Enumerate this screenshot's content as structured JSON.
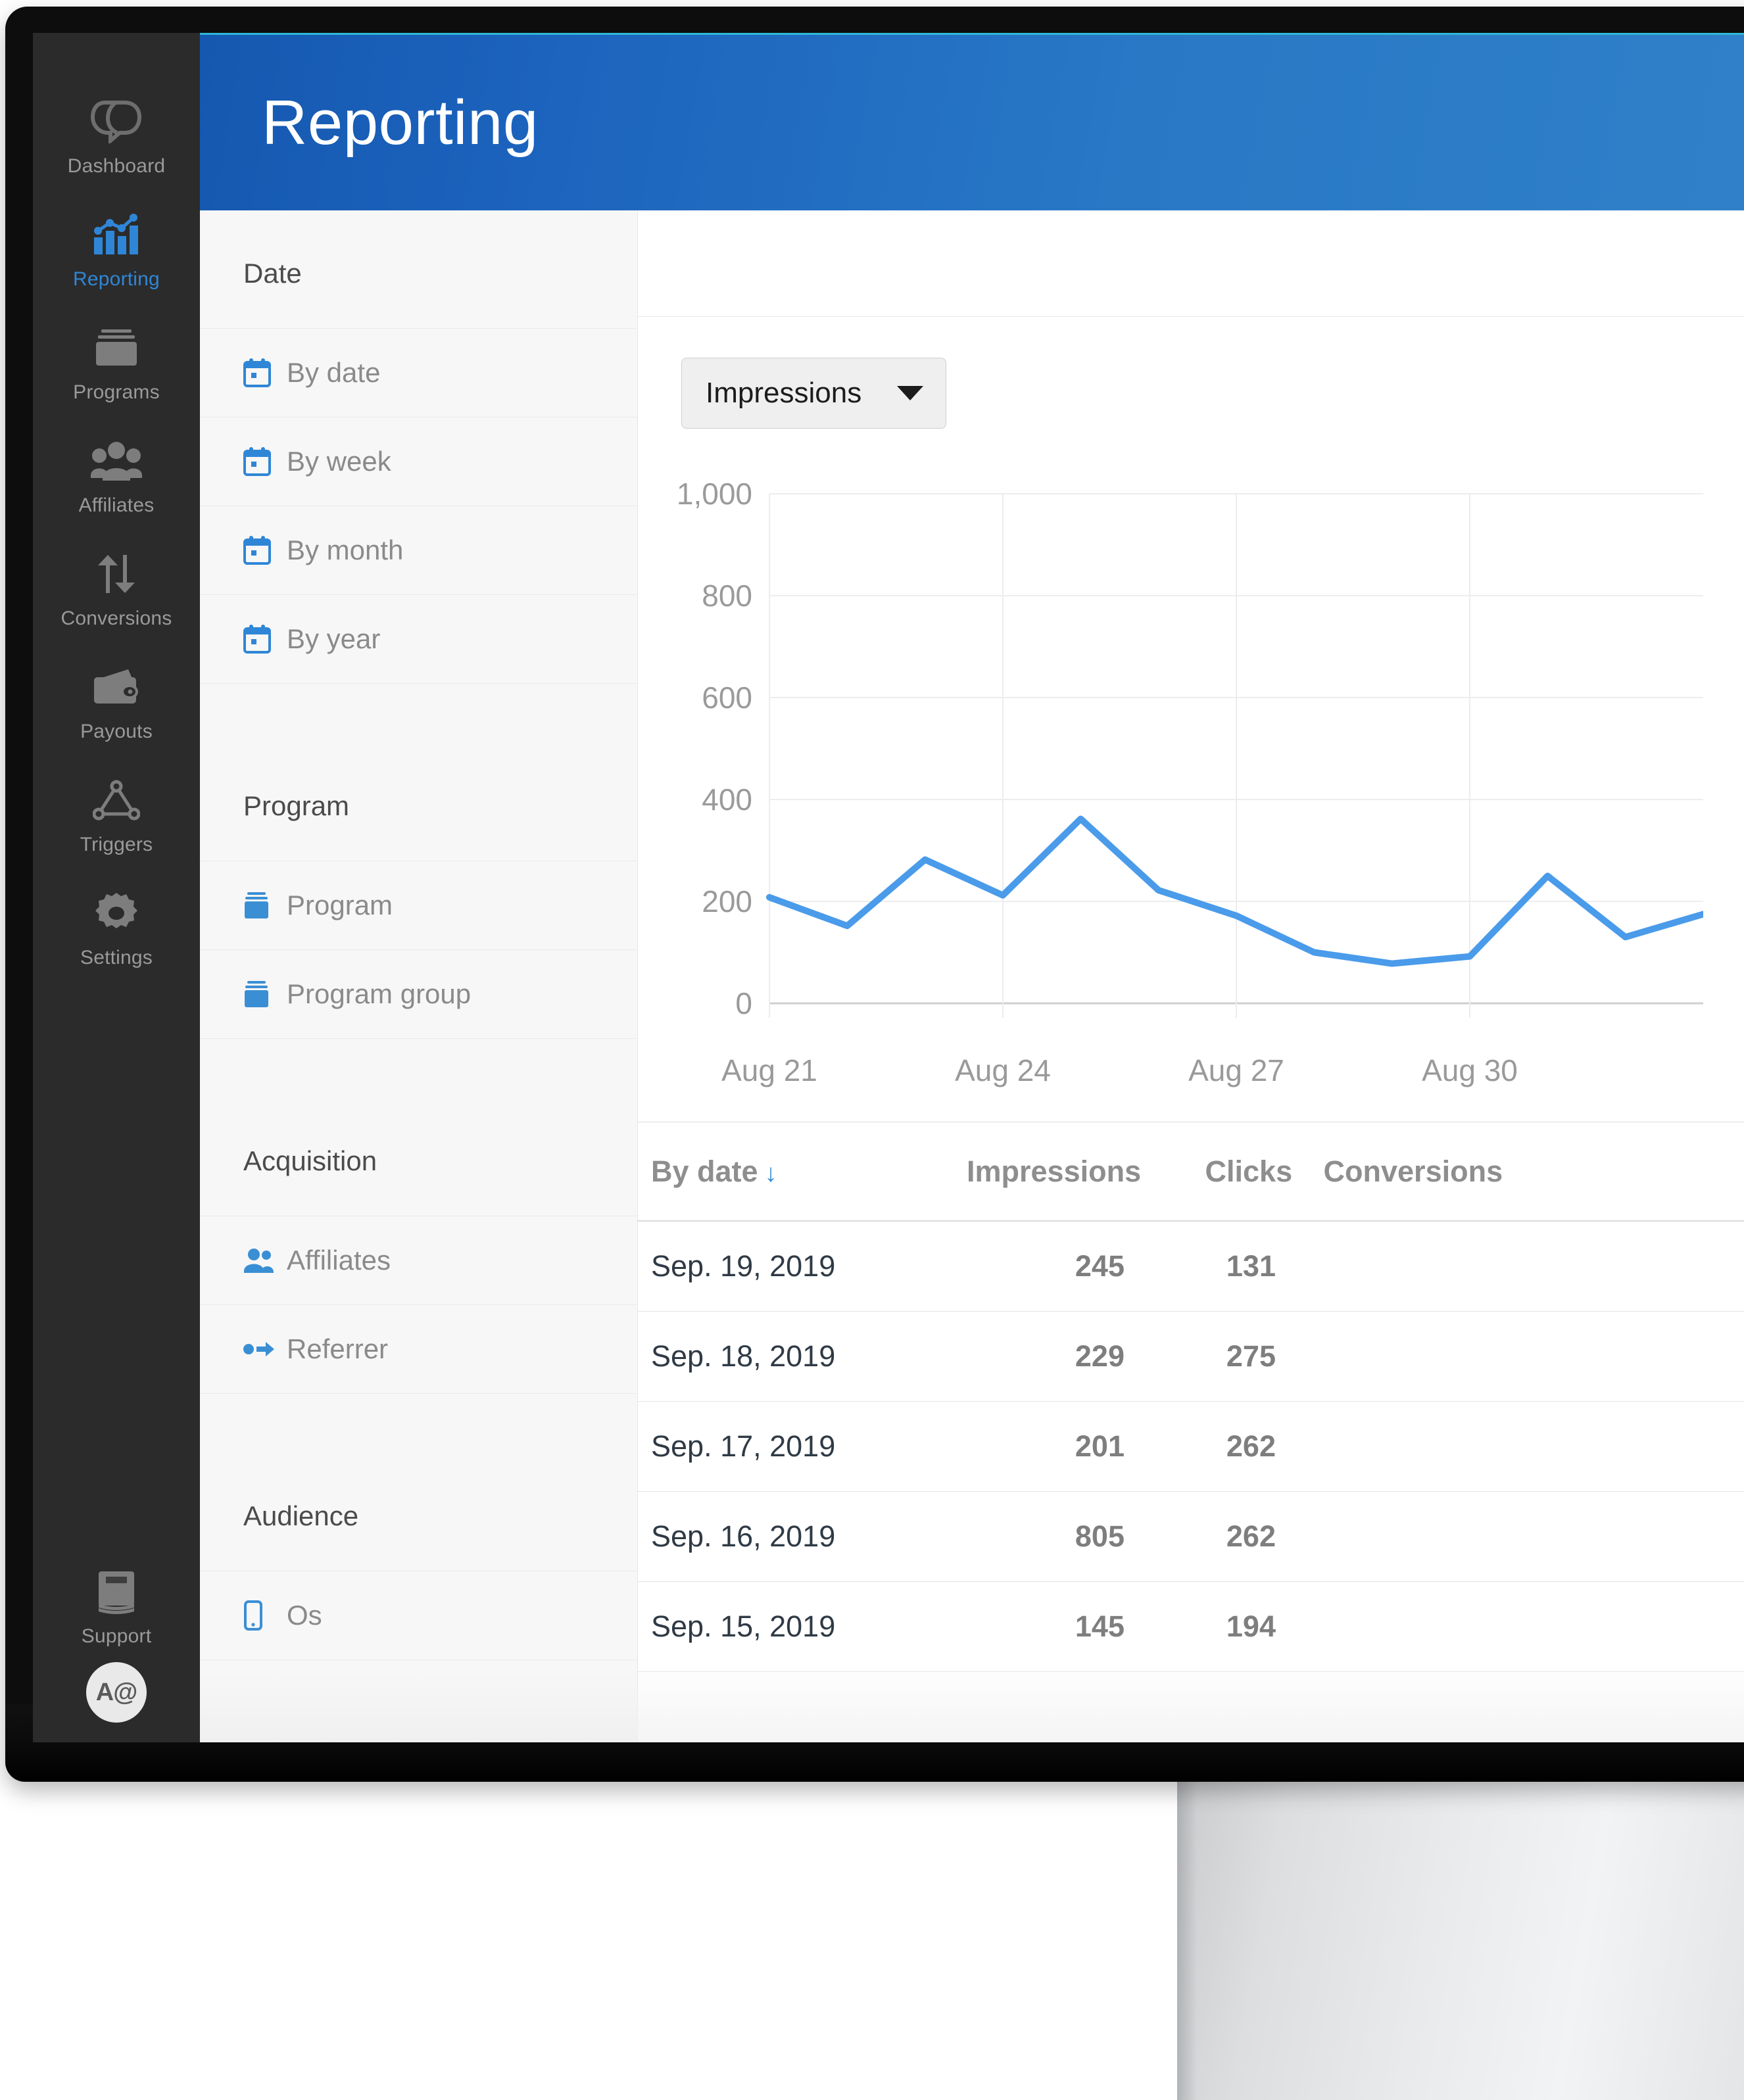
{
  "app": {
    "header_title": "Reporting",
    "accent_blue": "#2f86d6",
    "header_gradient_from": "#1558b0",
    "header_gradient_to": "#2f80c8",
    "top_accent_line": "#2fb8d8"
  },
  "rail": {
    "items": [
      {
        "label": "Dashboard",
        "icon": "logo-icon",
        "active": false
      },
      {
        "label": "Reporting",
        "icon": "bar-chart-icon",
        "active": true
      },
      {
        "label": "Programs",
        "icon": "folder-icon",
        "active": false
      },
      {
        "label": "Affiliates",
        "icon": "people-group-icon",
        "active": false
      },
      {
        "label": "Conversions",
        "icon": "arrows-up-down-icon",
        "active": false
      },
      {
        "label": "Payouts",
        "icon": "wallet-icon",
        "active": false
      },
      {
        "label": "Triggers",
        "icon": "triangle-nodes-icon",
        "active": false
      },
      {
        "label": "Settings",
        "icon": "gear-icon",
        "active": false
      },
      {
        "label": "Support",
        "icon": "book-icon",
        "active": false
      }
    ],
    "avatar_initials": "A@"
  },
  "subnav": {
    "groups": [
      {
        "title": "Date",
        "items": [
          {
            "label": "By date",
            "icon": "calendar-icon"
          },
          {
            "label": "By week",
            "icon": "calendar-icon"
          },
          {
            "label": "By month",
            "icon": "calendar-icon"
          },
          {
            "label": "By year",
            "icon": "calendar-icon"
          }
        ]
      },
      {
        "title": "Program",
        "items": [
          {
            "label": "Program",
            "icon": "archive-box-icon"
          },
          {
            "label": "Program group",
            "icon": "archive-box-icon"
          }
        ]
      },
      {
        "title": "Acquisition",
        "items": [
          {
            "label": "Affiliates",
            "icon": "users-icon"
          },
          {
            "label": "Referrer",
            "icon": "dot-arrow-icon"
          }
        ]
      },
      {
        "title": "Audience",
        "items": [
          {
            "label": "Os",
            "icon": "mobile-phone-icon"
          }
        ]
      }
    ]
  },
  "content": {
    "metric_select": {
      "value": "Impressions",
      "icon": "chevron-down-icon"
    },
    "table": {
      "columns": [
        "By date",
        "Impressions",
        "Clicks",
        "Conversions"
      ],
      "sort_column": "By date",
      "sort_direction": "descending",
      "sort_glyph": "↓",
      "rows": [
        {
          "date": "Sep. 19, 2019",
          "impressions": "245",
          "clicks": "131",
          "conversions": ""
        },
        {
          "date": "Sep. 18, 2019",
          "impressions": "229",
          "clicks": "275",
          "conversions": ""
        },
        {
          "date": "Sep. 17, 2019",
          "impressions": "201",
          "clicks": "262",
          "conversions": ""
        },
        {
          "date": "Sep. 16, 2019",
          "impressions": "805",
          "clicks": "262",
          "conversions": ""
        },
        {
          "date": "Sep. 15, 2019",
          "impressions": "145",
          "clicks": "194",
          "conversions": ""
        }
      ]
    }
  },
  "chart_data": {
    "type": "line",
    "title": "",
    "xlabel": "",
    "ylabel": "",
    "ylim": [
      0,
      1000
    ],
    "yticks": [
      0,
      200,
      400,
      600,
      800,
      1000
    ],
    "ytick_labels": [
      "0",
      "200",
      "400",
      "600",
      "800",
      "1,000"
    ],
    "xtick_labels": [
      "Aug 21",
      "Aug 24",
      "Aug 27",
      "Aug 30"
    ],
    "grid": true,
    "legend": "none",
    "line_color": "#4a9bea",
    "series": [
      {
        "name": "Impressions",
        "x": [
          "Aug 21",
          "Aug 22",
          "Aug 23",
          "Aug 24",
          "Aug 25",
          "Aug 26",
          "Aug 27",
          "Aug 28",
          "Aug 29",
          "Aug 30",
          "Aug 31",
          "Sep 1",
          "Sep 2"
        ],
        "values": [
          208,
          152,
          282,
          212,
          362,
          222,
          172,
          100,
          78,
          92,
          250,
          130,
          175
        ]
      }
    ]
  }
}
